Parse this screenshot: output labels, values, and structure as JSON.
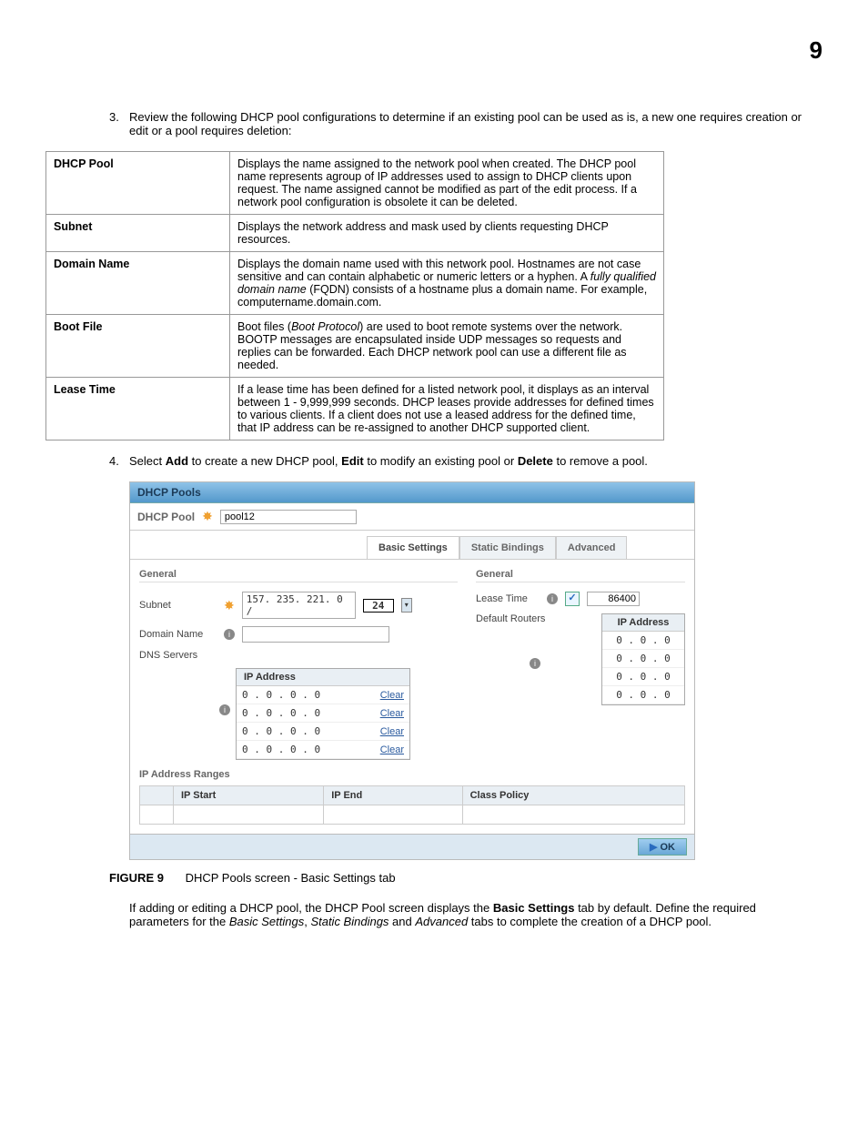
{
  "page_number": "9",
  "step3": {
    "num": "3.",
    "text_a": "Review the following DHCP pool configurations to determine if an existing pool can be used as is, a new one requires creation or edit or a pool requires deletion:"
  },
  "def_table": [
    {
      "label": "DHCP Pool",
      "desc": "Displays the name assigned to the network pool when created. The DHCP pool name represents agroup of IP addresses used to assign to DHCP clients upon request. The name assigned cannot be modified as part of the edit process. If a network pool configuration is obsolete it can be deleted."
    },
    {
      "label": "Subnet",
      "desc": "Displays the network address and mask used by clients requesting DHCP resources."
    },
    {
      "label": "Domain Name",
      "desc_pre": "Displays the domain name used with this network pool. Hostnames are not case sensitive and can contain alphabetic or numeric letters or a hyphen. A ",
      "desc_em": "fully qualified domain name",
      "desc_post": " (FQDN) consists of a hostname plus a domain name. For example, computername.domain.com."
    },
    {
      "label": "Boot File",
      "desc_pre": "Boot files (",
      "desc_em": "Boot Protocol",
      "desc_post": ") are used to boot remote systems over the network. BOOTP messages are encapsulated inside UDP messages so requests and replies can be forwarded. Each DHCP network pool can use a different file as needed."
    },
    {
      "label": "Lease Time",
      "desc": "If a lease time has been defined for a listed network pool, it displays as an interval between 1 - 9,999,999 seconds. DHCP leases provide addresses for defined times to various clients. If a client does not use a leased address for the defined time, that IP address can be re-assigned to another DHCP supported client."
    }
  ],
  "step4": {
    "num": "4.",
    "pre": "Select ",
    "b1": "Add",
    "mid1": " to create a new DHCP pool, ",
    "b2": "Edit",
    "mid2": " to modify an existing pool or ",
    "b3": "Delete",
    "post": " to remove a pool."
  },
  "screenshot": {
    "title": "DHCP Pools",
    "pool_label": "DHCP Pool",
    "pool_value": "pool12",
    "tabs": {
      "basic": "Basic Settings",
      "static": "Static Bindings",
      "advanced": "Advanced"
    },
    "left": {
      "general": "General",
      "subnet_label": "Subnet",
      "subnet_value": "157. 235. 221.  0 /",
      "cidr": "24",
      "domain_label": "Domain Name",
      "dns_label": "DNS Servers",
      "ip_header": "IP Address",
      "dns_rows": [
        {
          "ip": "0 .  0 .  0 .  0",
          "action": "Clear"
        },
        {
          "ip": "0 .  0 .  0 .  0",
          "action": "Clear"
        },
        {
          "ip": "0 .  0 .  0 .  0",
          "action": "Clear"
        },
        {
          "ip": "0 .  0 .  0 .  0",
          "action": "Clear"
        }
      ]
    },
    "right": {
      "general": "General",
      "lease_label": "Lease Time",
      "lease_value": "86400",
      "routers_label": "Default Routers",
      "ip_header": "IP Address",
      "router_rows": [
        "0 .  0 .  0",
        "0 .  0 .  0",
        "0 .  0 .  0",
        "0 .  0 .  0"
      ]
    },
    "ranges": {
      "title": "IP Address Ranges",
      "cols": {
        "start": "IP Start",
        "end": "IP End",
        "policy": "Class Policy"
      }
    },
    "ok": "OK"
  },
  "figure": {
    "label": "FIGURE 9",
    "caption": "DHCP Pools screen - Basic Settings tab"
  },
  "para_after": {
    "t1": "If adding or editing a DHCP pool, the DHCP Pool screen displays the ",
    "b1": "Basic Settings",
    "t2": " tab by default. Define the required parameters for the ",
    "e1": "Basic Settings",
    "t3": ", ",
    "e2": "Static Bindings",
    "t4": " and ",
    "e3": "Advanced",
    "t5": " tabs to complete the creation of a DHCP pool."
  }
}
